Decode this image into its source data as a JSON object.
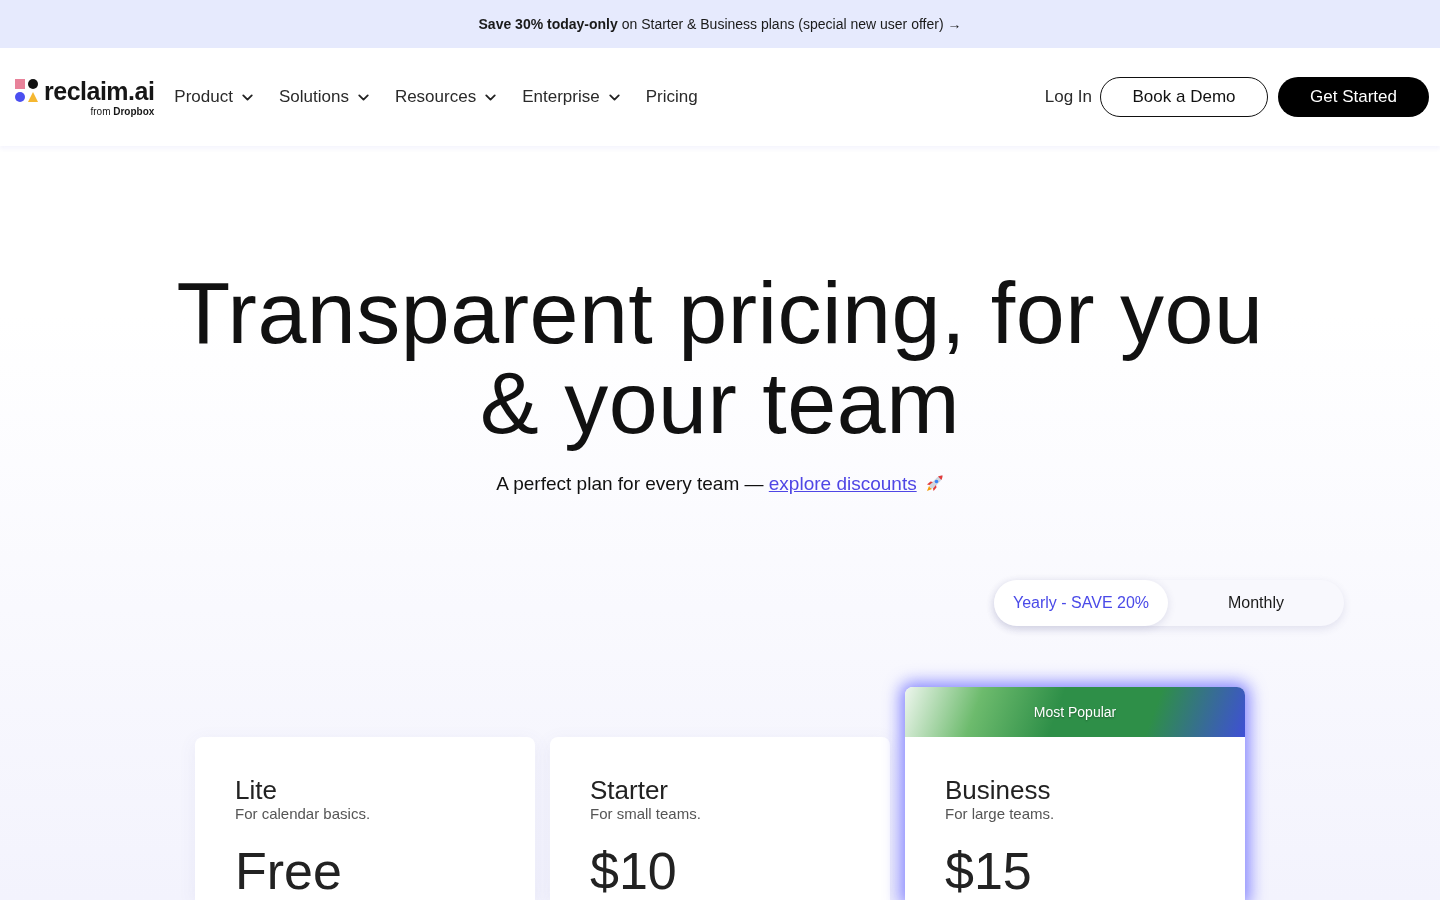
{
  "banner": {
    "text": "**Save 30% today-only** on Starter & Business plans (special new user offer) →"
  },
  "nav": {
    "logo": {
      "wordmark": "reclaim.ai",
      "tagline": "from **Dropbox**"
    },
    "menu": [
      {
        "label": "Product",
        "dropdown": true
      },
      {
        "label": "Solutions",
        "dropdown": true
      },
      {
        "label": "Resources",
        "dropdown": true
      },
      {
        "label": "Enterprise",
        "dropdown": true
      },
      {
        "label": "Pricing",
        "dropdown": false
      }
    ],
    "login": "Log In",
    "demo": "Book a Demo",
    "cta": "Get Started"
  },
  "hero": {
    "title_lines": [
      "Transparent pricing, for you",
      "& your team"
    ],
    "subtitle": "A perfect plan for every team —",
    "link": "explore discounts"
  },
  "billing_toggle": [
    {
      "label": "Yearly - SAVE 20%",
      "selected": true
    },
    {
      "label": "Monthly",
      "selected": false
    }
  ],
  "plans": [
    {
      "name": "Lite",
      "description": "For calendar basics.",
      "price": "Free",
      "featured": false
    },
    {
      "name": "Starter",
      "description": "For small teams.",
      "price": "$10",
      "featured": false
    },
    {
      "name": "Business",
      "description": "For large teams.",
      "price": "$15",
      "featured": true,
      "badge": "Most Popular"
    }
  ]
}
